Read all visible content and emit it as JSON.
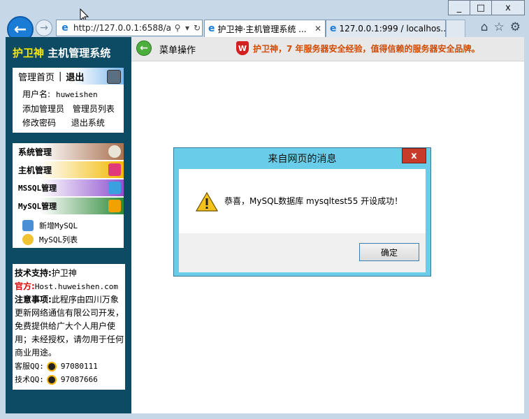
{
  "browser": {
    "address_url": "http://127.0.0.1:6588/a",
    "tabs": [
      {
        "label": "护卫神·主机管理系统 ...",
        "active": true
      },
      {
        "label": "127.0.0.1:999 / localhos...",
        "active": false
      }
    ],
    "window_buttons": [
      "_",
      "□",
      "x"
    ]
  },
  "sidebar": {
    "brand_highlight": "护卫神",
    "brand_rest": " 主机管理系统",
    "home_link": "管理首页",
    "separator": "|",
    "logout_link": "退出",
    "user_label": "用户名:",
    "username": "huweishen",
    "links": [
      "添加管理员",
      "管理员列表",
      "修改密码",
      "退出系统"
    ],
    "menu": [
      {
        "label": "系统管理"
      },
      {
        "label": "主机管理"
      },
      {
        "label": "MSSQL管理"
      },
      {
        "label": "MySQL管理"
      }
    ],
    "mysql_submenu": [
      "新增MySQL",
      "MySQL列表"
    ],
    "info": {
      "support_label": "技术支持:",
      "support_value": "护卫神",
      "official_label": "官方:",
      "official_value": "Host.huweishen.com",
      "notice_label": "注意事项:",
      "notice_text": "此程序由四川万象更新网络通信有限公司开发，免费提供给广大个人用户使用；未经授权，请勿用于任何商业用途。",
      "kefu_label": "客服QQ:",
      "kefu_qq": "97080111",
      "tech_label": "技术QQ:",
      "tech_qq": "97087666"
    }
  },
  "topbar": {
    "menu_op": "菜单操作",
    "slogan": "护卫神，7 年服务器安全经验，值得信赖的服务器安全品牌。"
  },
  "dialog": {
    "title": "来自网页的消息",
    "message": "恭喜，MySQL数据库 mysqltest55 开设成功！",
    "ok_label": "确定",
    "close_label": "x"
  },
  "colors": {
    "sidebar_bg": "#0d4a63",
    "brand_highlight": "#f8e800",
    "slogan": "#d24a00",
    "dialog_frame": "#69cdea",
    "dialog_close": "#c73b2b"
  }
}
